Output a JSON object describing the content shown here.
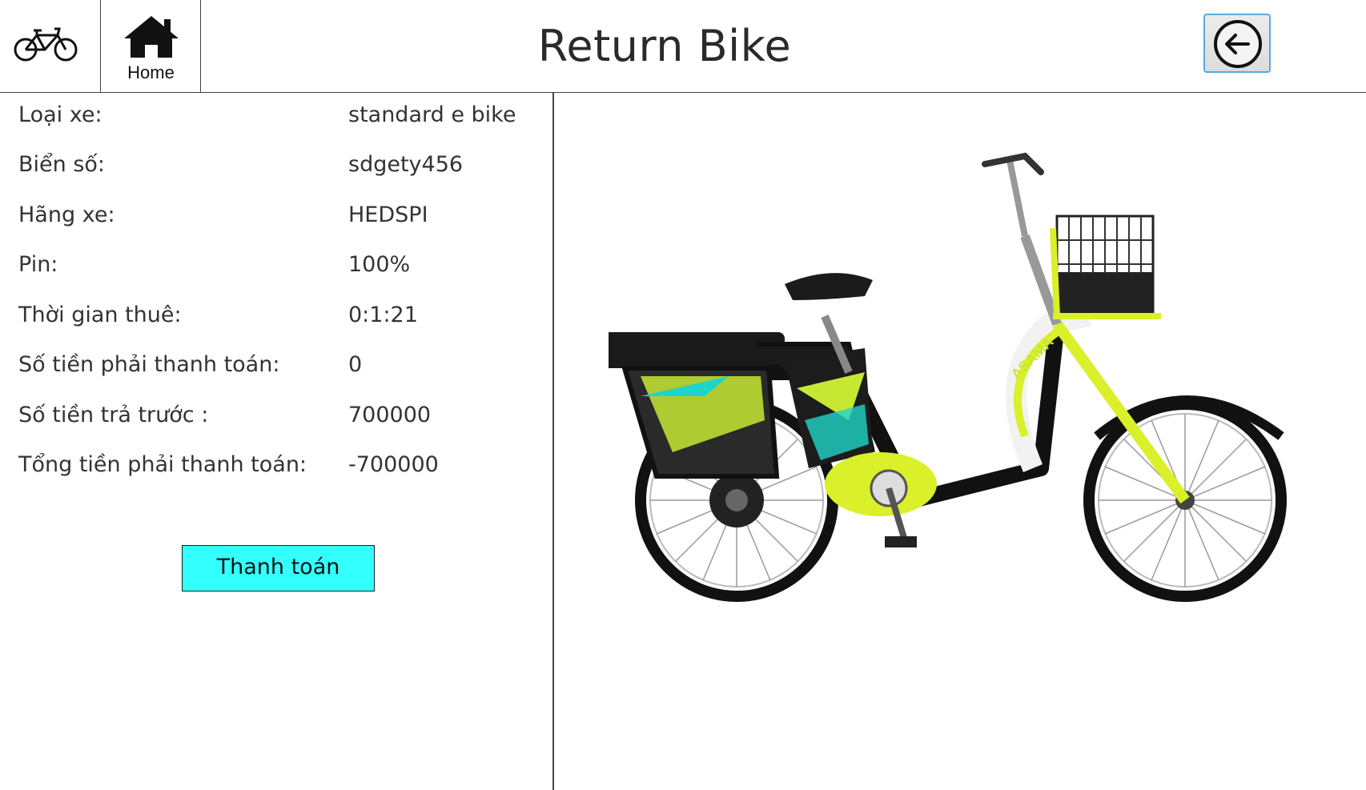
{
  "header": {
    "title": "Return Bike",
    "home_label": "Home",
    "logo_icon": "bicycle-icon",
    "home_icon": "home-icon",
    "back_icon": "arrow-left-circle-icon"
  },
  "bike_info": {
    "rows": [
      {
        "label": "Loại xe:",
        "value": "standard e bike"
      },
      {
        "label": "Biển số:",
        "value": "sdgety456"
      },
      {
        "label": "Hãng xe:",
        "value": "HEDSPI"
      },
      {
        "label": "Pin:",
        "value": "100%"
      },
      {
        "label": "Thời gian thuê:",
        "value": "0:1:21"
      },
      {
        "label": "Số tiền phải thanh toán:",
        "value": "0"
      },
      {
        "label": "Số tiền trả trước :",
        "value": "700000"
      },
      {
        "label": "Tổng tiền phải thanh toán:",
        "value": "-700000"
      }
    ]
  },
  "actions": {
    "pay_label": "Thanh toán"
  },
  "image": {
    "frame_brand_text": "ASAMA"
  },
  "colors": {
    "pay_button": "#33ffff",
    "back_button_border": "#5aa9e0",
    "bike_accent": "#d9f02a"
  }
}
